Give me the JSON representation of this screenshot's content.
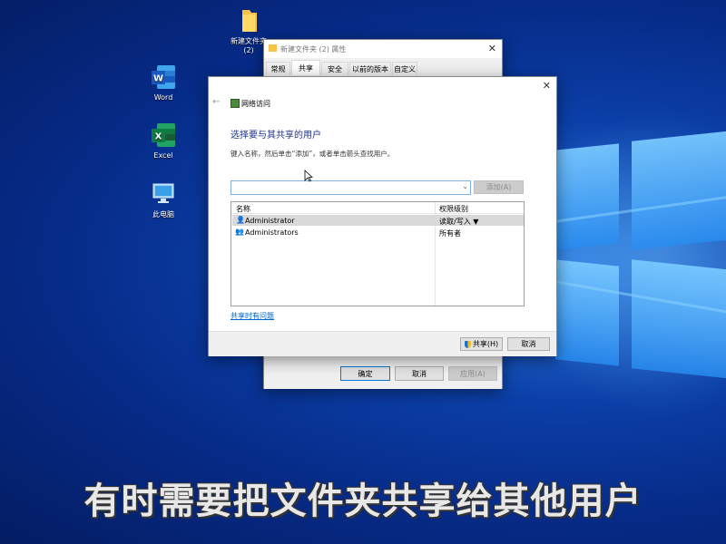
{
  "desktop": {
    "icons": [
      {
        "label": "新建文件夹\n(2)"
      },
      {
        "label": "Word"
      },
      {
        "label": "Excel"
      },
      {
        "label": "此电脑"
      }
    ]
  },
  "properties_window": {
    "title": "新建文件夹 (2) 属性",
    "tabs": [
      "常规",
      "共享",
      "安全",
      "以前的版本",
      "自定义"
    ],
    "active_tab": "共享",
    "ok_label": "确定",
    "cancel_label": "取消",
    "apply_label": "应用(A)"
  },
  "share_dialog": {
    "nav_title": "网络访问",
    "heading": "选择要与其共享的用户",
    "instruction": "键入名称，然后单击“添加”，或者单击箭头查找用户。",
    "add_button": "添加(A)",
    "columns": {
      "name": "名称",
      "permission": "权限级别"
    },
    "rows": [
      {
        "name": "Administrator",
        "permission": "读取/写入 ▼",
        "selected": true
      },
      {
        "name": "Administrators",
        "permission": "所有者",
        "selected": false
      }
    ],
    "help_link": "共享时有问题",
    "share_button": "共享(H)",
    "cancel_button": "取消"
  },
  "caption": "有时需要把文件夹共享给其他用户",
  "colors": {
    "accent": "#0078d7",
    "heading": "#1e3287",
    "link": "#0066cc",
    "selected_row": "#d9d9d9"
  }
}
